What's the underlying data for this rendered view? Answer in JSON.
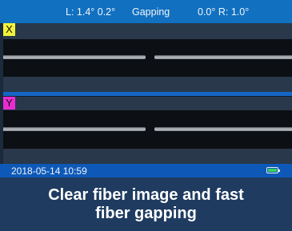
{
  "status_bar": {
    "left_angles": "L: 1.4°  0.2°",
    "mode": "Gapping",
    "right_angles": "0.0°  R: 1.0°"
  },
  "panels": [
    {
      "axis": "X",
      "tag_color": "#f2f23a"
    },
    {
      "axis": "Y",
      "tag_color": "#ea2bd2"
    }
  ],
  "footer": {
    "datetime": "2018-05-14  10:59",
    "battery_level": 0.9,
    "battery_icon": "battery-icon",
    "battery_color": "#39d15e"
  },
  "caption": {
    "line1": "Clear fiber image and fast",
    "line2": "fiber gapping"
  }
}
